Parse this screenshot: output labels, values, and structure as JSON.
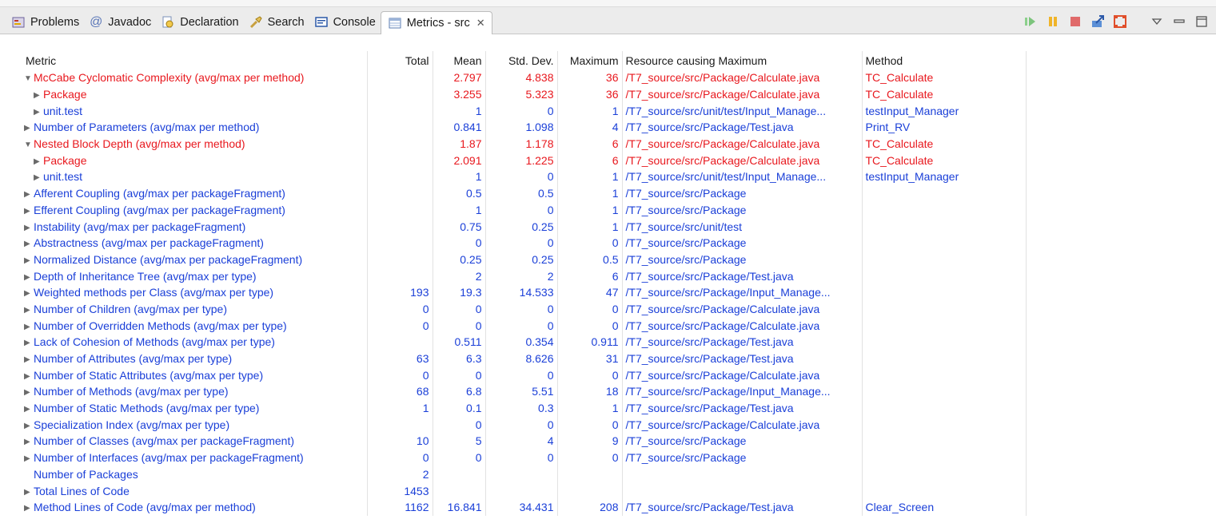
{
  "tabs": [
    {
      "label": "Problems",
      "icon": "problems-icon"
    },
    {
      "label": "Javadoc",
      "icon": "at-icon"
    },
    {
      "label": "Declaration",
      "icon": "declaration-icon"
    },
    {
      "label": "Search",
      "icon": "search-flashlight-icon"
    },
    {
      "label": "Console",
      "icon": "console-icon"
    },
    {
      "label": "Metrics - src",
      "icon": "metrics-icon",
      "active": true
    }
  ],
  "columns": [
    "Metric",
    "Total",
    "Mean",
    "Std. Dev.",
    "Maximum",
    "Resource causing Maximum",
    "Method"
  ],
  "colors": {
    "red": "#e8181e",
    "blue": "#1a3fd8"
  },
  "rows": [
    {
      "indent": 0,
      "twisty": "expanded",
      "color": "red",
      "metric": "McCabe Cyclomatic Complexity (avg/max per method)",
      "total": "",
      "mean": "2.797",
      "std": "4.838",
      "max": "36",
      "resource": "/T7_source/src/Package/Calculate.java",
      "method": "TC_Calculate"
    },
    {
      "indent": 1,
      "twisty": "collapsed",
      "color": "red",
      "metric": "Package",
      "total": "",
      "mean": "3.255",
      "std": "5.323",
      "max": "36",
      "resource": "/T7_source/src/Package/Calculate.java",
      "method": "TC_Calculate"
    },
    {
      "indent": 1,
      "twisty": "collapsed",
      "color": "blue",
      "metric": "unit.test",
      "total": "",
      "mean": "1",
      "std": "0",
      "max": "1",
      "resource": "/T7_source/src/unit/test/Input_Manage...",
      "method": "testInput_Manager"
    },
    {
      "indent": 0,
      "twisty": "collapsed",
      "color": "blue",
      "metric": "Number of Parameters (avg/max per method)",
      "total": "",
      "mean": "0.841",
      "std": "1.098",
      "max": "4",
      "resource": "/T7_source/src/Package/Test.java",
      "method": "Print_RV"
    },
    {
      "indent": 0,
      "twisty": "expanded",
      "color": "red",
      "metric": "Nested Block Depth (avg/max per method)",
      "total": "",
      "mean": "1.87",
      "std": "1.178",
      "max": "6",
      "resource": "/T7_source/src/Package/Calculate.java",
      "method": "TC_Calculate"
    },
    {
      "indent": 1,
      "twisty": "collapsed",
      "color": "red",
      "metric": "Package",
      "total": "",
      "mean": "2.091",
      "std": "1.225",
      "max": "6",
      "resource": "/T7_source/src/Package/Calculate.java",
      "method": "TC_Calculate"
    },
    {
      "indent": 1,
      "twisty": "collapsed",
      "color": "blue",
      "metric": "unit.test",
      "total": "",
      "mean": "1",
      "std": "0",
      "max": "1",
      "resource": "/T7_source/src/unit/test/Input_Manage...",
      "method": "testInput_Manager"
    },
    {
      "indent": 0,
      "twisty": "collapsed",
      "color": "blue",
      "metric": "Afferent Coupling (avg/max per packageFragment)",
      "total": "",
      "mean": "0.5",
      "std": "0.5",
      "max": "1",
      "resource": "/T7_source/src/Package",
      "method": ""
    },
    {
      "indent": 0,
      "twisty": "collapsed",
      "color": "blue",
      "metric": "Efferent Coupling (avg/max per packageFragment)",
      "total": "",
      "mean": "1",
      "std": "0",
      "max": "1",
      "resource": "/T7_source/src/Package",
      "method": ""
    },
    {
      "indent": 0,
      "twisty": "collapsed",
      "color": "blue",
      "metric": "Instability (avg/max per packageFragment)",
      "total": "",
      "mean": "0.75",
      "std": "0.25",
      "max": "1",
      "resource": "/T7_source/src/unit/test",
      "method": ""
    },
    {
      "indent": 0,
      "twisty": "collapsed",
      "color": "blue",
      "metric": "Abstractness (avg/max per packageFragment)",
      "total": "",
      "mean": "0",
      "std": "0",
      "max": "0",
      "resource": "/T7_source/src/Package",
      "method": ""
    },
    {
      "indent": 0,
      "twisty": "collapsed",
      "color": "blue",
      "metric": "Normalized Distance (avg/max per packageFragment)",
      "total": "",
      "mean": "0.25",
      "std": "0.25",
      "max": "0.5",
      "resource": "/T7_source/src/Package",
      "method": ""
    },
    {
      "indent": 0,
      "twisty": "collapsed",
      "color": "blue",
      "metric": "Depth of Inheritance Tree (avg/max per type)",
      "total": "",
      "mean": "2",
      "std": "2",
      "max": "6",
      "resource": "/T7_source/src/Package/Test.java",
      "method": ""
    },
    {
      "indent": 0,
      "twisty": "collapsed",
      "color": "blue",
      "metric": "Weighted methods per Class (avg/max per type)",
      "total": "193",
      "mean": "19.3",
      "std": "14.533",
      "max": "47",
      "resource": "/T7_source/src/Package/Input_Manage...",
      "method": ""
    },
    {
      "indent": 0,
      "twisty": "collapsed",
      "color": "blue",
      "metric": "Number of Children (avg/max per type)",
      "total": "0",
      "mean": "0",
      "std": "0",
      "max": "0",
      "resource": "/T7_source/src/Package/Calculate.java",
      "method": ""
    },
    {
      "indent": 0,
      "twisty": "collapsed",
      "color": "blue",
      "metric": "Number of Overridden Methods (avg/max per type)",
      "total": "0",
      "mean": "0",
      "std": "0",
      "max": "0",
      "resource": "/T7_source/src/Package/Calculate.java",
      "method": ""
    },
    {
      "indent": 0,
      "twisty": "collapsed",
      "color": "blue",
      "metric": "Lack of Cohesion of Methods (avg/max per type)",
      "total": "",
      "mean": "0.511",
      "std": "0.354",
      "max": "0.911",
      "resource": "/T7_source/src/Package/Test.java",
      "method": ""
    },
    {
      "indent": 0,
      "twisty": "collapsed",
      "color": "blue",
      "metric": "Number of Attributes (avg/max per type)",
      "total": "63",
      "mean": "6.3",
      "std": "8.626",
      "max": "31",
      "resource": "/T7_source/src/Package/Test.java",
      "method": ""
    },
    {
      "indent": 0,
      "twisty": "collapsed",
      "color": "blue",
      "metric": "Number of Static Attributes (avg/max per type)",
      "total": "0",
      "mean": "0",
      "std": "0",
      "max": "0",
      "resource": "/T7_source/src/Package/Calculate.java",
      "method": ""
    },
    {
      "indent": 0,
      "twisty": "collapsed",
      "color": "blue",
      "metric": "Number of Methods (avg/max per type)",
      "total": "68",
      "mean": "6.8",
      "std": "5.51",
      "max": "18",
      "resource": "/T7_source/src/Package/Input_Manage...",
      "method": ""
    },
    {
      "indent": 0,
      "twisty": "collapsed",
      "color": "blue",
      "metric": "Number of Static Methods (avg/max per type)",
      "total": "1",
      "mean": "0.1",
      "std": "0.3",
      "max": "1",
      "resource": "/T7_source/src/Package/Test.java",
      "method": ""
    },
    {
      "indent": 0,
      "twisty": "collapsed",
      "color": "blue",
      "metric": "Specialization Index (avg/max per type)",
      "total": "",
      "mean": "0",
      "std": "0",
      "max": "0",
      "resource": "/T7_source/src/Package/Calculate.java",
      "method": ""
    },
    {
      "indent": 0,
      "twisty": "collapsed",
      "color": "blue",
      "metric": "Number of Classes (avg/max per packageFragment)",
      "total": "10",
      "mean": "5",
      "std": "4",
      "max": "9",
      "resource": "/T7_source/src/Package",
      "method": ""
    },
    {
      "indent": 0,
      "twisty": "collapsed",
      "color": "blue",
      "metric": "Number of Interfaces (avg/max per packageFragment)",
      "total": "0",
      "mean": "0",
      "std": "0",
      "max": "0",
      "resource": "/T7_source/src/Package",
      "method": ""
    },
    {
      "indent": 0,
      "twisty": "none",
      "color": "blue",
      "metric": "Number of Packages",
      "total": "2",
      "mean": "",
      "std": "",
      "max": "",
      "resource": "",
      "method": ""
    },
    {
      "indent": 0,
      "twisty": "collapsed",
      "color": "blue",
      "metric": "Total Lines of Code",
      "total": "1453",
      "mean": "",
      "std": "",
      "max": "",
      "resource": "",
      "method": ""
    },
    {
      "indent": 0,
      "twisty": "collapsed",
      "color": "blue",
      "metric": "Method Lines of Code (avg/max per method)",
      "total": "1162",
      "mean": "16.841",
      "std": "34.431",
      "max": "208",
      "resource": "/T7_source/src/Package/Test.java",
      "method": "Clear_Screen"
    }
  ]
}
